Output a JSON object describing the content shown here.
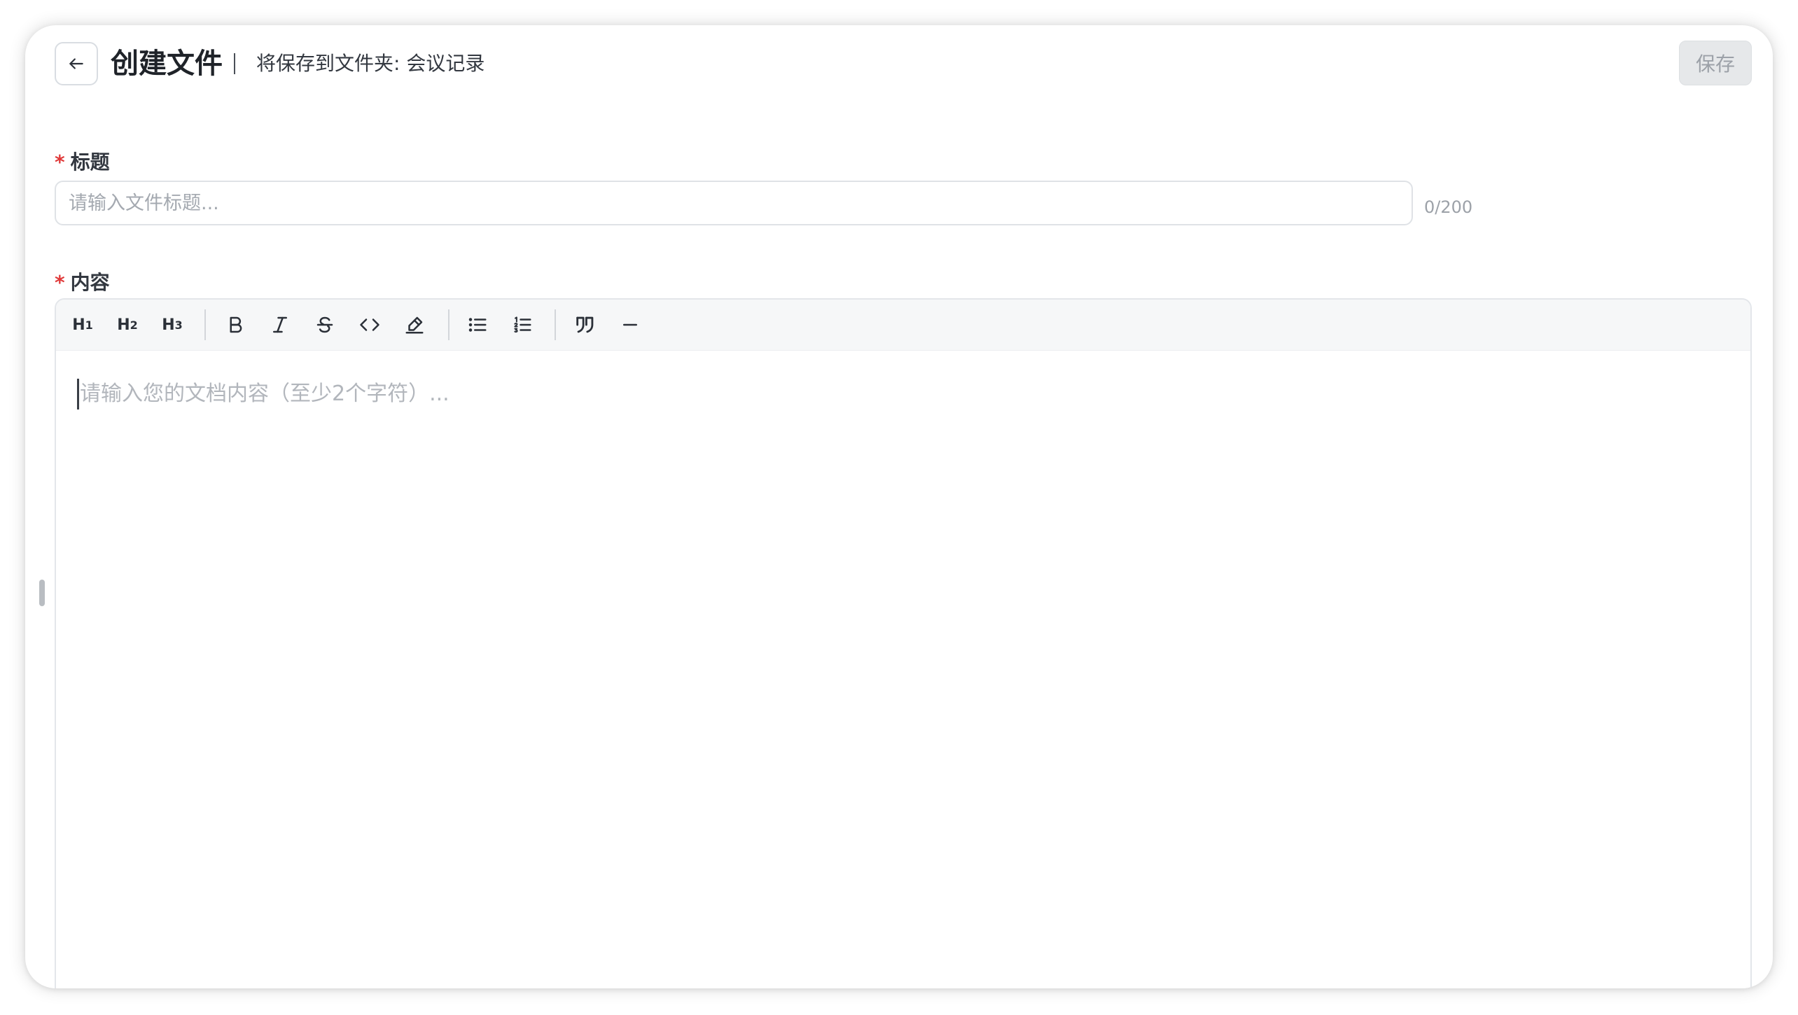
{
  "header": {
    "title": "创建文件",
    "save_hint": "将保存到文件夹: 会议记录",
    "save_label": "保存"
  },
  "form": {
    "title_label": "标题",
    "title_required_mark": "*",
    "title_placeholder": "请输入文件标题...",
    "title_value": "",
    "title_char_count": "0/200",
    "content_label": "内容",
    "content_required_mark": "*",
    "content_placeholder": "请输入您的文档内容（至少2个字符）..."
  },
  "toolbar": {
    "h1_label": "H",
    "h1_sub": "1",
    "h2_label": "H",
    "h2_sub": "2",
    "h3_label": "H",
    "h3_sub": "3",
    "icons": [
      "bold-icon",
      "italic-icon",
      "strikethrough-icon",
      "code-icon",
      "highlight-icon",
      "bullet-list-icon",
      "ordered-list-icon",
      "blockquote-icon",
      "horizontal-rule-icon"
    ]
  },
  "colors": {
    "required": "#e03a3a",
    "save_disabled_bg": "#e6e8ea",
    "toolbar_bg": "#f6f7f8"
  }
}
